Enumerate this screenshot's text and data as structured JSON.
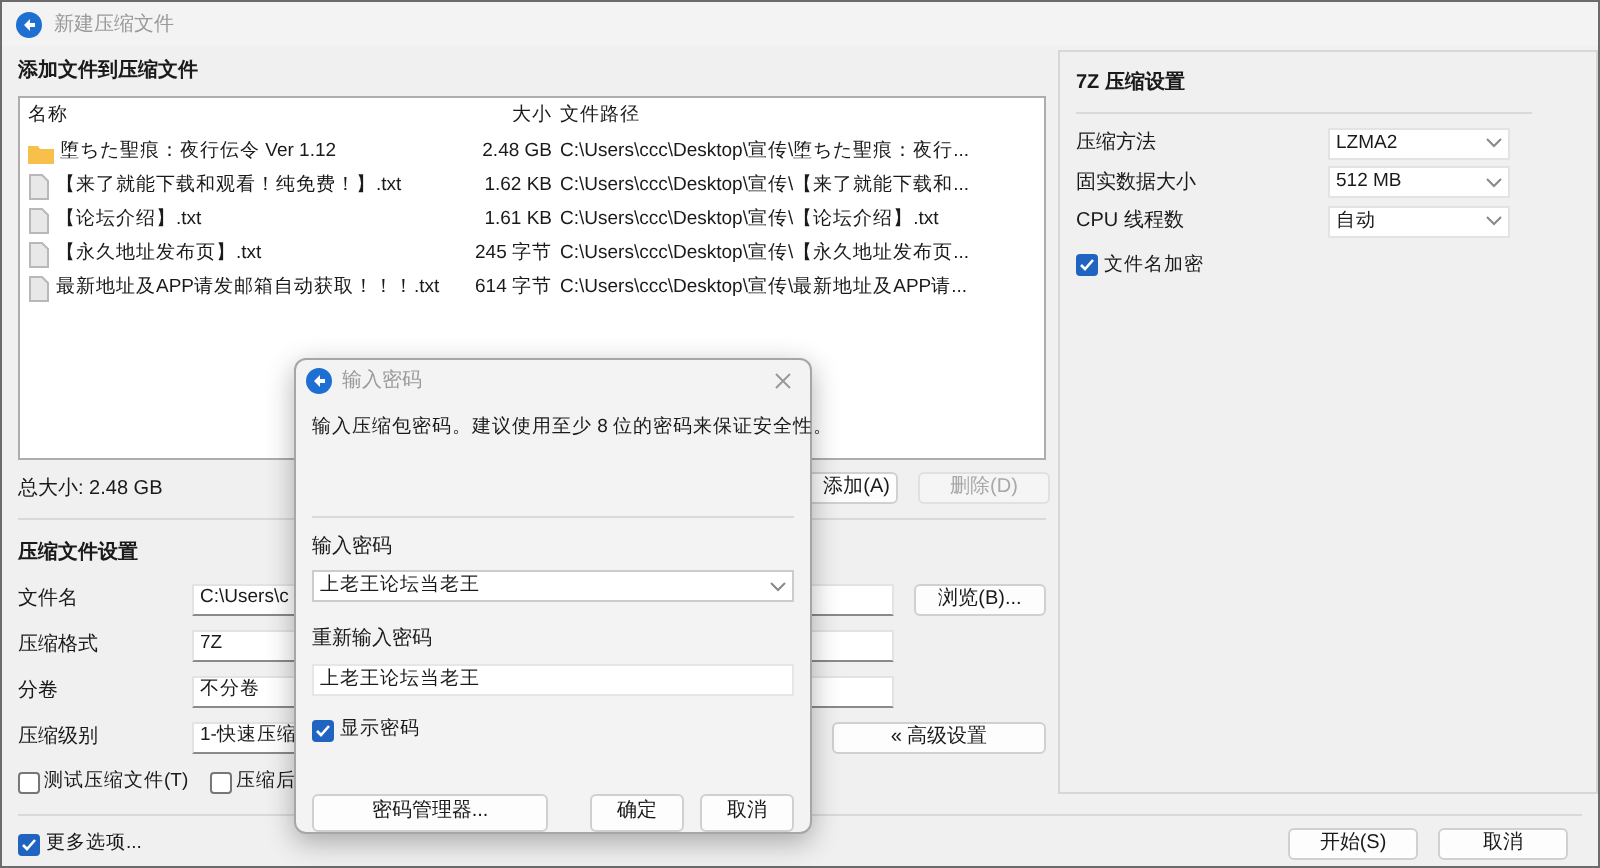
{
  "window": {
    "title": "新建压缩文件"
  },
  "files": {
    "heading": "添加文件到压缩文件",
    "columns": [
      "名称",
      "大小",
      "文件路径"
    ],
    "rows": [
      {
        "kind": "folder",
        "name": "堕ちた聖痕：夜行伝令 Ver 1.12",
        "size": "2.48 GB",
        "path": "C:\\Users\\ccc\\Desktop\\宣传\\堕ちた聖痕：夜行..."
      },
      {
        "kind": "file",
        "name": "【来了就能下载和观看！纯免费！】.txt",
        "size": "1.62 KB",
        "path": "C:\\Users\\ccc\\Desktop\\宣传\\【来了就能下载和..."
      },
      {
        "kind": "file",
        "name": "【论坛介绍】.txt",
        "size": "1.61 KB",
        "path": "C:\\Users\\ccc\\Desktop\\宣传\\【论坛介绍】.txt"
      },
      {
        "kind": "file",
        "name": "【永久地址发布页】.txt",
        "size": "245 字节",
        "path": "C:\\Users\\ccc\\Desktop\\宣传\\【永久地址发布页..."
      },
      {
        "kind": "file",
        "name": "最新地址及APP请发邮箱自动获取！！！.txt",
        "size": "614 字节",
        "path": "C:\\Users\\ccc\\Desktop\\宣传\\最新地址及APP请..."
      }
    ],
    "total": "总大小: 2.48 GB",
    "buttons": [
      {
        "label": "添加(A)",
        "disabled": false
      },
      {
        "label": "删除(D)",
        "disabled": true
      }
    ]
  },
  "archive_settings": {
    "heading": "压缩文件设置",
    "fields": [
      {
        "label": "文件名",
        "value": "C:\\Users\\c",
        "button": "浏览(B)..."
      },
      {
        "label": "压缩格式",
        "value": "7Z"
      },
      {
        "label": "分卷",
        "value": "不分卷"
      },
      {
        "label": "压缩级别",
        "value": "1-快速压缩",
        "button": "« 高级设置"
      }
    ],
    "options": [
      {
        "label": "测试压缩文件(T)",
        "checked": false
      },
      {
        "label": "压缩后",
        "checked": false
      }
    ]
  },
  "more_options": {
    "label": "更多选项...",
    "checked": true
  },
  "footer_buttons": [
    "开始(S)",
    "取消"
  ],
  "format_panel": {
    "heading": "7Z 压缩设置",
    "fields": [
      {
        "label": "压缩方法",
        "value": "LZMA2"
      },
      {
        "label": "固实数据大小",
        "value": "512 MB"
      },
      {
        "label": "CPU 线程数",
        "value": "自动"
      }
    ],
    "option": {
      "label": "文件名加密",
      "checked": true
    }
  },
  "password_dialog": {
    "title": "输入密码",
    "message": "输入压缩包密码。建议使用至少 8 位的密码来保证安全性。",
    "password_label": "输入密码",
    "password": "上老王论坛当老王",
    "confirm_label": "重新输入密码",
    "confirm": "上老王论坛当老王",
    "show_password": {
      "label": "显示密码",
      "checked": true
    },
    "buttons": [
      "密码管理器...",
      "确定",
      "取消"
    ]
  }
}
